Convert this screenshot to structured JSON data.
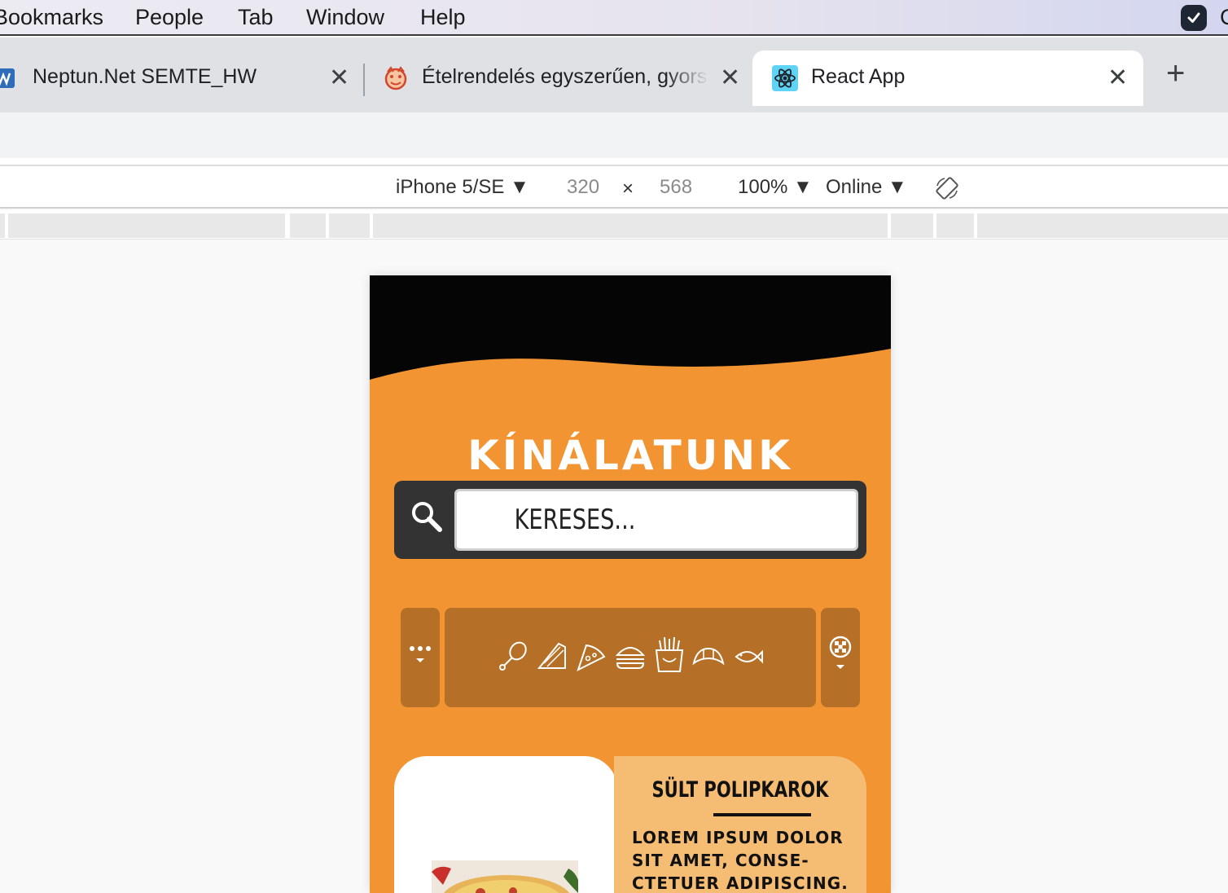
{
  "menubar": {
    "items": [
      "Bookmarks",
      "People",
      "Tab",
      "Window",
      "Help"
    ],
    "trailing_text": "C"
  },
  "tabs": [
    {
      "title": "Neptun.Net SEMTE_HW",
      "active": false
    },
    {
      "title": "Ételrendelés egyszerűen, gyors",
      "active": false
    },
    {
      "title": "React App",
      "active": true
    }
  ],
  "devtools": {
    "device": "iPhone 5/SE ▼",
    "width": "320",
    "times": "×",
    "height": "568",
    "zoom": "100% ▼",
    "network": "Online ▼"
  },
  "page": {
    "section_title": "KÍNÁLATUNK",
    "search_placeholder": "KERESES...",
    "categories": [
      "chicken-leg-icon",
      "sandwich-icon",
      "pizza-slice-icon",
      "burger-icon",
      "fries-icon",
      "croissant-icon",
      "fish-icon"
    ],
    "card": {
      "title": "SÜLT POLIPKAROK",
      "description": "Lorem ipsum dolor sit amet, conse-ctetuer adipiscing. Si ipsum dolor"
    }
  },
  "colors": {
    "page_orange": "#f29432",
    "filter_brown": "#b56f26",
    "card_peach": "#f5bd73",
    "search_dark": "#333333"
  }
}
